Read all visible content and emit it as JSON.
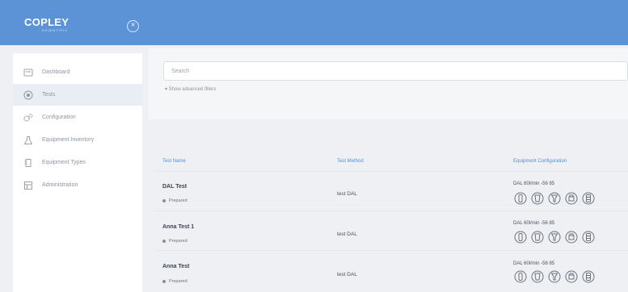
{
  "header": {
    "logo_text": "COPLEY",
    "logo_sub": "SCIENTIFIC",
    "collapse_icon": "close-circle-icon"
  },
  "sidebar": {
    "items": [
      {
        "label": "Dashboard",
        "icon": "dashboard-icon"
      },
      {
        "label": "Tests",
        "icon": "target-icon",
        "active": true
      },
      {
        "label": "Configuration",
        "icon": "gears-icon"
      },
      {
        "label": "Equipment Inventory",
        "icon": "flask-icon"
      },
      {
        "label": "Equipment Types",
        "icon": "document-icon"
      },
      {
        "label": "Administration",
        "icon": "grid-icon"
      }
    ]
  },
  "search": {
    "placeholder": "Search",
    "advanced_toggle": "▾ Show advanced filters"
  },
  "table": {
    "headers": {
      "name": "Test Name",
      "method": "Test Method",
      "config": "Equipment Configuration"
    },
    "rows": [
      {
        "name": "DAL Test",
        "status": "Prepared",
        "method": "test DAL",
        "config": "DAL 60l/min -56 85"
      },
      {
        "name": "Anna Test 1",
        "status": "Prepared",
        "method": "test DAL",
        "config": "DAL 60l/min -56 85"
      },
      {
        "name": "Anna Test",
        "status": "Prepared",
        "method": "test DAL",
        "config": "DAL 60l/min -56 85"
      }
    ],
    "equipment_icons": [
      "inhaler-icon",
      "mouthpiece-icon",
      "adapter-icon",
      "collection-tube-icon",
      "filter-icon"
    ]
  }
}
